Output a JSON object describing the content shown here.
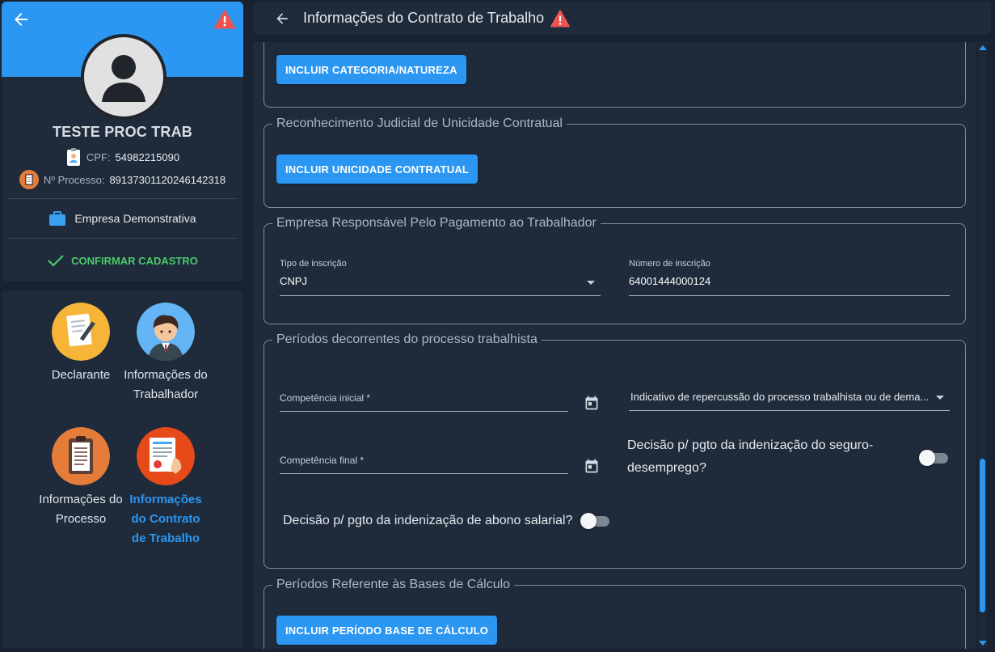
{
  "profile": {
    "name": "TESTE PROC TRAB",
    "cpf_label": "CPF:",
    "cpf": "54982215090",
    "process_label": "Nº Processo:",
    "process": "89137301120246142318",
    "company": "Empresa Demonstrativa",
    "confirm_label": "CONFIRMAR CADASTRO"
  },
  "nav": {
    "items": [
      {
        "label": "Declarante",
        "icon": "document-pen-icon"
      },
      {
        "label": "Informações do Trabalhador",
        "icon": "worker-icon"
      },
      {
        "label": "Informações do Processo",
        "icon": "clipboard-icon"
      },
      {
        "label": "Informações do Contrato de Trabalho",
        "icon": "contract-icon",
        "active": true
      }
    ]
  },
  "header": {
    "title": "Informações do Contrato de Trabalho"
  },
  "sections": {
    "categoria": {
      "button": "INCLUIR CATEGORIA/NATUREZA"
    },
    "unicidade": {
      "legend": "Reconhecimento Judicial de Unicidade Contratual",
      "button": "INCLUIR UNICIDADE CONTRATUAL"
    },
    "empresa": {
      "legend": "Empresa Responsável Pelo Pagamento ao Trabalhador",
      "tipo_label": "Tipo de inscrição",
      "tipo_value": "CNPJ",
      "numero_label": "Número de inscrição",
      "numero_value": "64001444000124"
    },
    "periodos": {
      "legend": "Períodos decorrentes do processo trabalhista",
      "comp_inicial": "Competência inicial *",
      "comp_final": "Competência final *",
      "indicativo": "Indicativo de repercussão do processo trabalhista ou de dema...",
      "seguro_line1": "Decisão p/ pgto da indenização do seguro-",
      "seguro_line2": "desemprego?",
      "abono": "Decisão p/ pgto da indenização de abono salarial?",
      "seguro_on": false,
      "abono_on": false
    },
    "bases": {
      "legend": "Períodos Referente às Bases de Cálculo",
      "button": "INCLUIR PERÍODO BASE DE CÁLCULO"
    }
  },
  "colors": {
    "accent": "#2b97f2",
    "success": "#4bc96a",
    "warning": "#ef5350",
    "panel": "#1f2b3a",
    "background": "#182230"
  }
}
